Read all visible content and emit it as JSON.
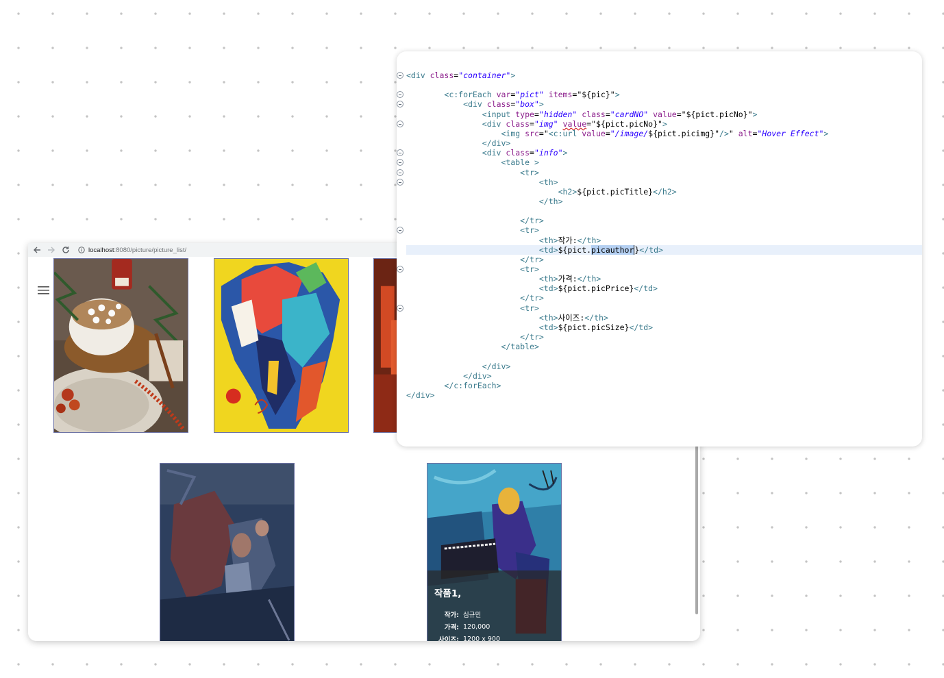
{
  "browser": {
    "url_host": "localhost",
    "url_path": ":8080/picture/picture_list/",
    "colors": {
      "chrome_bg": "#f1f3f4",
      "thumb_border": "#6c72a4"
    },
    "icons": [
      "back-arrow-icon",
      "forward-arrow-icon",
      "reload-icon",
      "info-icon",
      "hamburger-menu-icon"
    ],
    "thumbnails": [
      "cocoa-mug-photo",
      "colorful-horse-painting",
      "red-abstract-painting",
      "blue-figures-painting",
      "blue-pianist-painting"
    ],
    "card": {
      "title": "작품1,",
      "rows": [
        {
          "label": "작가:",
          "value": "심규민"
        },
        {
          "label": "가격:",
          "value": "120,000"
        },
        {
          "label": "사이즈:",
          "value": "1200 x 900"
        }
      ]
    }
  },
  "editor": {
    "lines": [
      {
        "fold": true,
        "tokens": [
          [
            "t",
            "<div "
          ],
          [
            "a",
            "class"
          ],
          [
            "p",
            "="
          ],
          [
            "v",
            "\"container\""
          ],
          [
            "t",
            ">"
          ]
        ]
      },
      {
        "fold": false,
        "tokens": []
      },
      {
        "fold": true,
        "tokens": [
          [
            "p",
            "        "
          ],
          [
            "t",
            "<c:forEach "
          ],
          [
            "a",
            "var"
          ],
          [
            "p",
            "="
          ],
          [
            "v",
            "\"pict\""
          ],
          [
            "p",
            " "
          ],
          [
            "a",
            "items"
          ],
          [
            "p",
            "=\"${pic}\""
          ],
          [
            "t",
            ">"
          ]
        ]
      },
      {
        "fold": true,
        "tokens": [
          [
            "p",
            "            "
          ],
          [
            "t",
            "<div "
          ],
          [
            "a",
            "class"
          ],
          [
            "p",
            "="
          ],
          [
            "v",
            "\"box\""
          ],
          [
            "t",
            ">"
          ]
        ]
      },
      {
        "fold": false,
        "tokens": [
          [
            "p",
            "                "
          ],
          [
            "t",
            "<input "
          ],
          [
            "a",
            "type"
          ],
          [
            "p",
            "="
          ],
          [
            "v",
            "\"hidden\""
          ],
          [
            "p",
            " "
          ],
          [
            "a",
            "class"
          ],
          [
            "p",
            "="
          ],
          [
            "v",
            "\"cardNO\""
          ],
          [
            "p",
            " "
          ],
          [
            "a",
            "value"
          ],
          [
            "p",
            "=\"${pict.picNo}\""
          ],
          [
            "t",
            ">"
          ]
        ]
      },
      {
        "fold": true,
        "tokens": [
          [
            "p",
            "                "
          ],
          [
            "t",
            "<div "
          ],
          [
            "a",
            "class"
          ],
          [
            "p",
            "="
          ],
          [
            "v",
            "\"img\""
          ],
          [
            "p",
            " "
          ],
          [
            "a",
            "value",
            "squig"
          ],
          [
            "p",
            "=\"${pict.picNo}\""
          ],
          [
            "t",
            ">"
          ]
        ]
      },
      {
        "fold": false,
        "tokens": [
          [
            "p",
            "                    "
          ],
          [
            "t",
            "<img "
          ],
          [
            "a",
            "src"
          ],
          [
            "p",
            "=\""
          ],
          [
            "t",
            "<c:url "
          ],
          [
            "a",
            "value"
          ],
          [
            "p",
            "="
          ],
          [
            "v",
            "\"/image/"
          ],
          [
            "p",
            "${pict.picimg}\""
          ],
          [
            "t",
            "/>"
          ],
          [
            "p",
            "\" "
          ],
          [
            "a",
            "alt"
          ],
          [
            "p",
            "="
          ],
          [
            "v",
            "\"Hover Effect\""
          ],
          [
            "t",
            ">"
          ]
        ]
      },
      {
        "fold": false,
        "tokens": [
          [
            "p",
            "                "
          ],
          [
            "t",
            "</div>"
          ]
        ]
      },
      {
        "fold": true,
        "tokens": [
          [
            "p",
            "                "
          ],
          [
            "t",
            "<div "
          ],
          [
            "a",
            "class"
          ],
          [
            "p",
            "="
          ],
          [
            "v",
            "\"info\""
          ],
          [
            "t",
            ">"
          ]
        ]
      },
      {
        "fold": true,
        "tokens": [
          [
            "p",
            "                    "
          ],
          [
            "t",
            "<table >"
          ]
        ]
      },
      {
        "fold": true,
        "tokens": [
          [
            "p",
            "                        "
          ],
          [
            "t",
            "<tr>"
          ]
        ]
      },
      {
        "fold": true,
        "tokens": [
          [
            "p",
            "                            "
          ],
          [
            "t",
            "<th>"
          ]
        ]
      },
      {
        "fold": false,
        "tokens": [
          [
            "p",
            "                                "
          ],
          [
            "t",
            "<h2>"
          ],
          [
            "p",
            "${pict.picTitle}"
          ],
          [
            "t",
            "</h2>"
          ]
        ]
      },
      {
        "fold": false,
        "tokens": [
          [
            "p",
            "                            "
          ],
          [
            "t",
            "</th>"
          ]
        ]
      },
      {
        "fold": false,
        "tokens": []
      },
      {
        "fold": false,
        "tokens": [
          [
            "p",
            "                        "
          ],
          [
            "t",
            "</tr>"
          ]
        ]
      },
      {
        "fold": true,
        "tokens": [
          [
            "p",
            "                        "
          ],
          [
            "t",
            "<tr>"
          ]
        ]
      },
      {
        "fold": false,
        "tokens": [
          [
            "p",
            "                            "
          ],
          [
            "t",
            "<th>"
          ],
          [
            "p",
            "작가:"
          ],
          [
            "t",
            "</th>"
          ]
        ]
      },
      {
        "fold": false,
        "highlight": true,
        "tokens": [
          [
            "p",
            "                            "
          ],
          [
            "t",
            "<td>"
          ],
          [
            "p",
            "${pict."
          ],
          [
            "p",
            "picauthor",
            "sel"
          ],
          [
            "p",
            "}",
            "caret"
          ],
          [
            "t",
            "</td>"
          ]
        ]
      },
      {
        "fold": false,
        "tokens": [
          [
            "p",
            "                        "
          ],
          [
            "t",
            "</tr>"
          ]
        ]
      },
      {
        "fold": true,
        "tokens": [
          [
            "p",
            "                        "
          ],
          [
            "t",
            "<tr>"
          ]
        ]
      },
      {
        "fold": false,
        "tokens": [
          [
            "p",
            "                            "
          ],
          [
            "t",
            "<th>"
          ],
          [
            "p",
            "가격:"
          ],
          [
            "t",
            "</th>"
          ]
        ]
      },
      {
        "fold": false,
        "tokens": [
          [
            "p",
            "                            "
          ],
          [
            "t",
            "<td>"
          ],
          [
            "p",
            "${pict.picPrice}"
          ],
          [
            "t",
            "</td>"
          ]
        ]
      },
      {
        "fold": false,
        "tokens": [
          [
            "p",
            "                        "
          ],
          [
            "t",
            "</tr>"
          ]
        ]
      },
      {
        "fold": true,
        "tokens": [
          [
            "p",
            "                        "
          ],
          [
            "t",
            "<tr>"
          ]
        ]
      },
      {
        "fold": false,
        "tokens": [
          [
            "p",
            "                            "
          ],
          [
            "t",
            "<th>"
          ],
          [
            "p",
            "사이즈:"
          ],
          [
            "t",
            "</th>"
          ]
        ]
      },
      {
        "fold": false,
        "tokens": [
          [
            "p",
            "                            "
          ],
          [
            "t",
            "<td>"
          ],
          [
            "p",
            "${pict.picSize}"
          ],
          [
            "t",
            "</td>"
          ]
        ]
      },
      {
        "fold": false,
        "tokens": [
          [
            "p",
            "                        "
          ],
          [
            "t",
            "</tr>"
          ]
        ]
      },
      {
        "fold": false,
        "tokens": [
          [
            "p",
            "                    "
          ],
          [
            "t",
            "</table>"
          ]
        ]
      },
      {
        "fold": false,
        "tokens": []
      },
      {
        "fold": false,
        "tokens": [
          [
            "p",
            "                "
          ],
          [
            "t",
            "</div>"
          ]
        ]
      },
      {
        "fold": false,
        "tokens": [
          [
            "p",
            "            "
          ],
          [
            "t",
            "</div>"
          ]
        ]
      },
      {
        "fold": false,
        "tokens": [
          [
            "p",
            "        "
          ],
          [
            "t",
            "</c:forEach>"
          ]
        ]
      },
      {
        "fold": false,
        "tokens": [
          [
            "t",
            "</div>"
          ]
        ]
      }
    ],
    "colors": {
      "tag": "#3a7a8c",
      "attribute": "#8b1d8b",
      "string": "#2a00ff",
      "highlight": "#e8f0fb",
      "selection": "#b5d0f2"
    }
  }
}
